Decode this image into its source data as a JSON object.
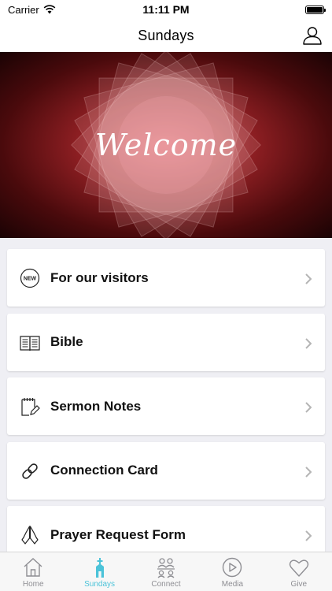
{
  "status_bar": {
    "carrier": "Carrier",
    "time": "11:11 PM",
    "battery_level": 1.0
  },
  "nav": {
    "title": "Sundays"
  },
  "hero": {
    "text": "Welcome"
  },
  "menu": {
    "items": [
      {
        "label": "For our visitors",
        "icon": "new-badge-icon",
        "icon_text": "NEW"
      },
      {
        "label": "Bible",
        "icon": "book-icon"
      },
      {
        "label": "Sermon Notes",
        "icon": "notepad-icon"
      },
      {
        "label": "Connection Card",
        "icon": "link-icon"
      },
      {
        "label": "Prayer Request Form",
        "icon": "praying-hands-icon"
      }
    ]
  },
  "tabs": [
    {
      "label": "Home",
      "icon": "home-icon",
      "active": false
    },
    {
      "label": "Sundays",
      "icon": "church-icon",
      "active": true
    },
    {
      "label": "Connect",
      "icon": "people-icon",
      "active": false
    },
    {
      "label": "Media",
      "icon": "play-icon",
      "active": false
    },
    {
      "label": "Give",
      "icon": "heart-icon",
      "active": false
    }
  ],
  "colors": {
    "accent": "#4cc3d9",
    "inactive_tab": "#8e8e93",
    "hero_center": "#c9474f",
    "hero_edge": "#1a0304"
  }
}
